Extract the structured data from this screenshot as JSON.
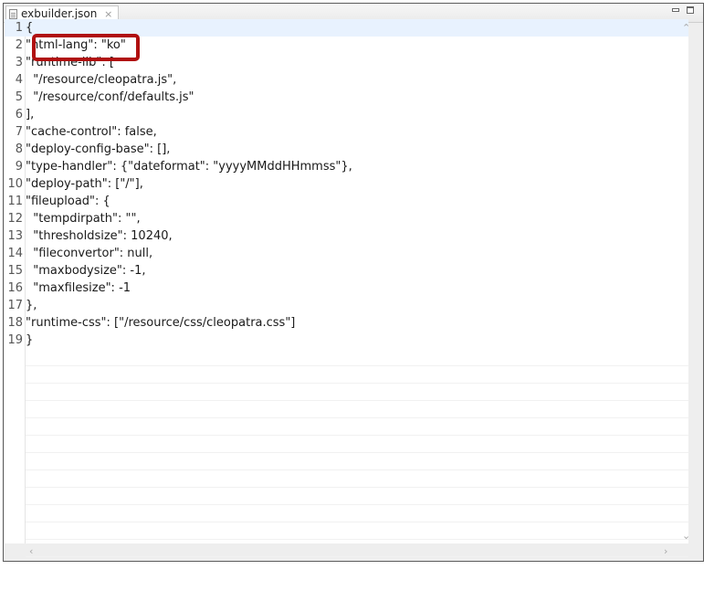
{
  "tab": {
    "title": "exbuilder.json",
    "close_glyph": "×",
    "icon": "file-icon"
  },
  "window_controls": {
    "minimize": "minimize-icon",
    "maximize": "maximize-icon"
  },
  "lines": [
    {
      "num": "1",
      "text": "{"
    },
    {
      "num": "2",
      "text": "\"html-lang\": \"ko\""
    },
    {
      "num": "3",
      "text": "\"runtime-lib\": ["
    },
    {
      "num": "4",
      "text": "  \"/resource/cleopatra.js\","
    },
    {
      "num": "5",
      "text": "  \"/resource/conf/defaults.js\""
    },
    {
      "num": "6",
      "text": "],"
    },
    {
      "num": "7",
      "text": "\"cache-control\": false,"
    },
    {
      "num": "8",
      "text": "\"deploy-config-base\": [],"
    },
    {
      "num": "9",
      "text": "\"type-handler\": {\"dateformat\": \"yyyyMMddHHmmss\"},"
    },
    {
      "num": "10",
      "text": "\"deploy-path\": [\"/\"],"
    },
    {
      "num": "11",
      "text": "\"fileupload\": {"
    },
    {
      "num": "12",
      "text": "  \"tempdirpath\": \"\","
    },
    {
      "num": "13",
      "text": "  \"thresholdsize\": 10240,"
    },
    {
      "num": "14",
      "text": "  \"fileconvertor\": null,"
    },
    {
      "num": "15",
      "text": "  \"maxbodysize\": -1,"
    },
    {
      "num": "16",
      "text": "  \"maxfilesize\": -1"
    },
    {
      "num": "17",
      "text": "},"
    },
    {
      "num": "18",
      "text": "\"runtime-css\": [\"/resource/css/cleopatra.css\"]"
    },
    {
      "num": "19",
      "text": "}"
    }
  ],
  "colors": {
    "highlight_box": "#b01010",
    "current_line": "#e8f2fe"
  }
}
